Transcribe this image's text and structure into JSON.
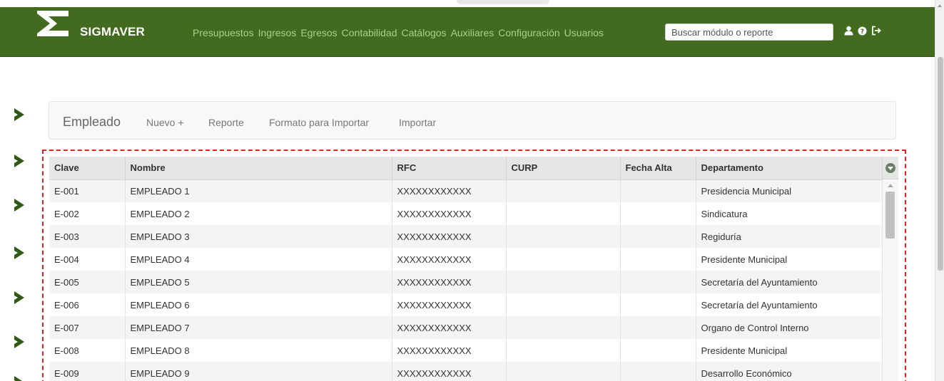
{
  "app": {
    "brand": "SIGMAVER",
    "accent_color": "#426b1f",
    "menu": [
      {
        "label": "Presupuestos"
      },
      {
        "label": "Ingresos"
      },
      {
        "label": "Egresos"
      },
      {
        "label": "Contabilidad"
      },
      {
        "label": "Catálogos"
      },
      {
        "label": "Auxiliares"
      },
      {
        "label": "Configuración"
      },
      {
        "label": "Usuarios"
      }
    ],
    "search": {
      "placeholder": "Buscar módulo o reporte",
      "value": ""
    },
    "icons": [
      "user-icon",
      "help-icon",
      "logout-icon"
    ]
  },
  "toolbar": {
    "title": "Empleado",
    "new_label": "Nuevo +",
    "report_label": "Reporte",
    "format_label": "Formato para Importar",
    "import_label": "Importar"
  },
  "table": {
    "columns": [
      "Clave",
      "Nombre",
      "RFC",
      "CURP",
      "Fecha Alta",
      "Departamento"
    ],
    "rows": [
      [
        "E-001",
        "EMPLEADO 1",
        "XXXXXXXXXXXX",
        "",
        "",
        "Presidencia Municipal"
      ],
      [
        "E-002",
        "EMPLEADO 2",
        "XXXXXXXXXXXX",
        "",
        "",
        "Sindicatura"
      ],
      [
        "E-003",
        "EMPLEADO 3",
        "XXXXXXXXXXXX",
        "",
        "",
        "Regiduría"
      ],
      [
        "E-004",
        "EMPLEADO 4",
        "XXXXXXXXXXXX",
        "",
        "",
        "Presidente Municipal"
      ],
      [
        "E-005",
        "EMPLEADO 5",
        "XXXXXXXXXXXX",
        "",
        "",
        "Secretaría del Ayuntamiento"
      ],
      [
        "E-006",
        "EMPLEADO 6",
        "XXXXXXXXXXXX",
        "",
        "",
        "Secretaría del Ayuntamiento"
      ],
      [
        "E-007",
        "EMPLEADO 7",
        "XXXXXXXXXXXX",
        "",
        "",
        "Organo de Control Interno"
      ],
      [
        "E-008",
        "EMPLEADO 8",
        "XXXXXXXXXXXX",
        "",
        "",
        "Presidente Municipal"
      ],
      [
        "E-009",
        "EMPLEADO 9",
        "XXXXXXXXXXXX",
        "",
        "",
        "Desarrollo Económico"
      ]
    ]
  },
  "sidebar": {
    "arrow_color": "#2f5a16",
    "arrow_icon": "chevron-right-icon"
  },
  "highlight_color": "#e02020"
}
